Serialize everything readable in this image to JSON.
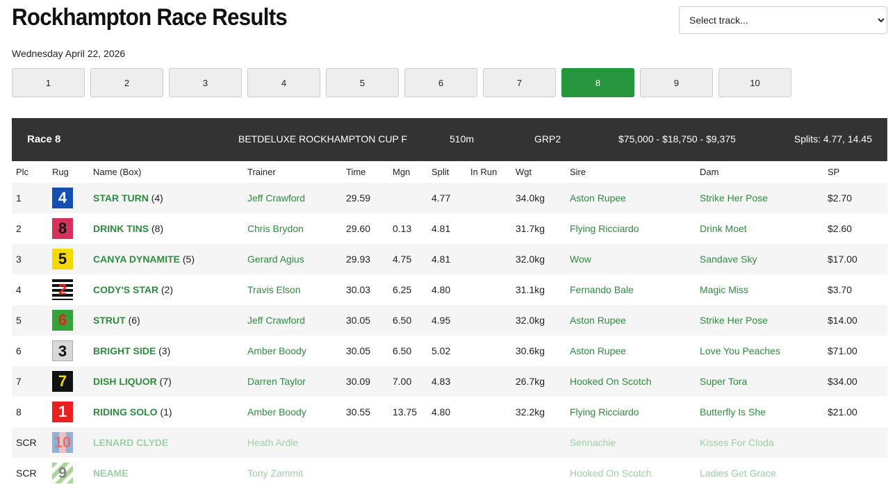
{
  "page": {
    "title": "Rockhampton Race Results",
    "date": "Wednesday April 22, 2026",
    "track_select": {
      "selected": "Select track..."
    }
  },
  "race_nav": {
    "active": 8,
    "races": [
      "1",
      "2",
      "3",
      "4",
      "5",
      "6",
      "7",
      "8",
      "9",
      "10"
    ]
  },
  "race_header": {
    "race_label": "Race 8",
    "race_name": "BETDELUXE ROCKHAMPTON CUP F",
    "distance": "510m",
    "grade": "GRP2",
    "prizes": "$75,000 - $18,750 - $9,375",
    "splits": "Splits: 4.77, 14.45"
  },
  "table": {
    "headers": [
      "Plc",
      "Rug",
      "Name (Box)",
      "Trainer",
      "Time",
      "Mgn",
      "Split",
      "In Run",
      "Wgt",
      "Sire",
      "Dam",
      "SP"
    ],
    "rows": [
      {
        "plc": "1",
        "rug": "4",
        "name": "STAR TURN",
        "box": "(4)",
        "trainer": "Jeff Crawford",
        "time": "29.59",
        "mgn": "",
        "split": "4.77",
        "inrun": "",
        "wgt": "34.0kg",
        "sire": "Aston Rupee",
        "dam": "Strike Her Pose",
        "sp": "$2.70"
      },
      {
        "plc": "2",
        "rug": "8",
        "name": "DRINK TINS",
        "box": "(8)",
        "trainer": "Chris Brydon",
        "time": "29.60",
        "mgn": "0.13",
        "split": "4.81",
        "inrun": "",
        "wgt": "31.7kg",
        "sire": "Flying Ricciardo",
        "dam": "Drink Moet",
        "sp": "$2.60"
      },
      {
        "plc": "3",
        "rug": "5",
        "name": "CANYA DYNAMITE",
        "box": "(5)",
        "trainer": "Gerard Agius",
        "time": "29.93",
        "mgn": "4.75",
        "split": "4.81",
        "inrun": "",
        "wgt": "32.0kg",
        "sire": "Wow",
        "dam": "Sandave Sky",
        "sp": "$17.00"
      },
      {
        "plc": "4",
        "rug": "2",
        "name": "CODY'S STAR",
        "box": "(2)",
        "trainer": "Travis Elson",
        "time": "30.03",
        "mgn": "6.25",
        "split": "4.80",
        "inrun": "",
        "wgt": "31.1kg",
        "sire": "Fernando Bale",
        "dam": "Magic Miss",
        "sp": "$3.70"
      },
      {
        "plc": "5",
        "rug": "6",
        "name": "STRUT",
        "box": "(6)",
        "trainer": "Jeff Crawford",
        "time": "30.05",
        "mgn": "6.50",
        "split": "4.95",
        "inrun": "",
        "wgt": "32.0kg",
        "sire": "Aston Rupee",
        "dam": "Strike Her Pose",
        "sp": "$14.00"
      },
      {
        "plc": "6",
        "rug": "3",
        "name": "BRIGHT SIDE",
        "box": "(3)",
        "trainer": "Amber Boody",
        "time": "30.05",
        "mgn": "6.50",
        "split": "5.02",
        "inrun": "",
        "wgt": "30.6kg",
        "sire": "Aston Rupee",
        "dam": "Love You Peaches",
        "sp": "$71.00"
      },
      {
        "plc": "7",
        "rug": "7",
        "name": "DISH LIQUOR",
        "box": "(7)",
        "trainer": "Darren Taylor",
        "time": "30.09",
        "mgn": "7.00",
        "split": "4.83",
        "inrun": "",
        "wgt": "26.7kg",
        "sire": "Hooked On Scotch",
        "dam": "Super Tora",
        "sp": "$34.00"
      },
      {
        "plc": "8",
        "rug": "1",
        "name": "RIDING SOLO",
        "box": "(1)",
        "trainer": "Amber Boody",
        "time": "30.55",
        "mgn": "13.75",
        "split": "4.80",
        "inrun": "",
        "wgt": "32.2kg",
        "sire": "Flying Ricciardo",
        "dam": "Butterfly Is She",
        "sp": "$21.00"
      },
      {
        "plc": "SCR",
        "rug": "10",
        "name": "LENARD CLYDE",
        "box": "",
        "trainer": "Heath Ardle",
        "time": "",
        "mgn": "",
        "split": "",
        "inrun": "",
        "wgt": "",
        "sire": "Sennachie",
        "dam": "Kisses For Cloda",
        "sp": "",
        "scratched": true
      },
      {
        "plc": "SCR",
        "rug": "9",
        "name": "NEAME",
        "box": "",
        "trainer": "Tony Zammit",
        "time": "",
        "mgn": "",
        "split": "",
        "inrun": "",
        "wgt": "",
        "sire": "Hooked On Scotch",
        "dam": "Ladies Get Grace",
        "sp": "",
        "scratched": true
      }
    ]
  }
}
